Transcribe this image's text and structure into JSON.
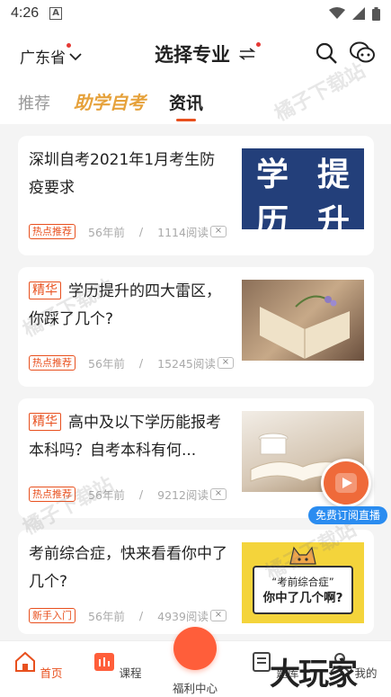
{
  "status": {
    "time": "4:26"
  },
  "header": {
    "province": "广东省",
    "title": "选择专业"
  },
  "tabs": [
    {
      "label": "推荐"
    },
    {
      "label": "助学自考"
    },
    {
      "label": "资讯"
    }
  ],
  "articles": [
    {
      "title": "深圳自考2021年1月考生防疫要求",
      "badge": "",
      "tag": "热点推荐",
      "time": "56年前",
      "reads": "1114阅读",
      "thumb_text": [
        "学",
        "提",
        "历",
        "升"
      ]
    },
    {
      "title": "学历提升的四大雷区，你踩了几个?",
      "badge": "精华",
      "tag": "热点推荐",
      "time": "56年前",
      "reads": "15245阅读"
    },
    {
      "title": "高中及以下学历能报考本科吗？自考本科有何...",
      "badge": "精华",
      "tag": "热点推荐",
      "time": "56年前",
      "reads": "9212阅读"
    },
    {
      "title": "考前综合症，快来看看你中了几个?",
      "badge": "",
      "tag": "新手入门",
      "time": "56年前",
      "reads": "4939阅读",
      "thumb_lines": [
        "“考前综合症”",
        "你中了几个啊?"
      ]
    }
  ],
  "float_live": {
    "label": "免费订阅直播"
  },
  "watermark": "橘子下载站",
  "bottom_nav": [
    {
      "label": "首页"
    },
    {
      "label": "课程"
    },
    {
      "label": "福利中心"
    },
    {
      "label": "题库"
    },
    {
      "label": "我的"
    }
  ],
  "brand_mark": "大玩家",
  "colors": {
    "accent": "#e8501e",
    "brand_gold": "#e6a23c",
    "live_blue": "#2a8cf0",
    "navy": "#233f7a"
  }
}
